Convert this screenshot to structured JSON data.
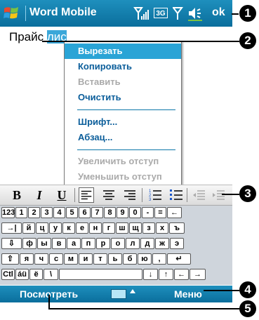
{
  "title_bar": {
    "app_title": "Word Mobile",
    "network_3g": "3G",
    "ok_label": "ok"
  },
  "document": {
    "text_before": "Прайс ",
    "selected_text": "лис"
  },
  "context_menu": {
    "items": [
      {
        "label": "Вырезать",
        "state": "highlighted"
      },
      {
        "label": "Копировать",
        "state": "enabled"
      },
      {
        "label": "Вставить",
        "state": "disabled"
      },
      {
        "label": "Очистить",
        "state": "enabled"
      },
      {
        "label": "Шрифт...",
        "state": "enabled"
      },
      {
        "label": "Абзац...",
        "state": "enabled"
      },
      {
        "label": "Увеличить отступ",
        "state": "disabled"
      },
      {
        "label": "Уменьшить отступ",
        "state": "disabled"
      }
    ]
  },
  "format_toolbar": {
    "bold": "B",
    "italic": "I",
    "underline": "U"
  },
  "keyboard": {
    "row1": [
      "123",
      "1",
      "2",
      "3",
      "4",
      "5",
      "6",
      "7",
      "8",
      "9",
      "0",
      "-",
      "=",
      "←"
    ],
    "row2": [
      "→|",
      "й",
      "ц",
      "у",
      "к",
      "е",
      "н",
      "г",
      "ш",
      "щ",
      "з",
      "х",
      "ъ"
    ],
    "row3": [
      "⇩",
      "ф",
      "ы",
      "в",
      "а",
      "п",
      "р",
      "о",
      "л",
      "д",
      "ж",
      "э"
    ],
    "row4": [
      "⇧",
      "я",
      "ч",
      "с",
      "м",
      "и",
      "т",
      "ь",
      "б",
      "ю",
      ",",
      "↵"
    ],
    "row5": [
      "Ctl",
      "áü",
      "ё",
      "\\",
      "",
      "↓",
      "↑",
      "←",
      "→"
    ]
  },
  "bottom_bar": {
    "left_softkey": "Посмотреть",
    "right_softkey": "Меню"
  },
  "callouts": [
    "1",
    "2",
    "3",
    "4",
    "5"
  ],
  "colors": {
    "bar_blue": "#0a6e9c",
    "highlight": "#2aa4d6",
    "menu_text": "#0a5d9a",
    "disabled_text": "#aaaaaa"
  }
}
